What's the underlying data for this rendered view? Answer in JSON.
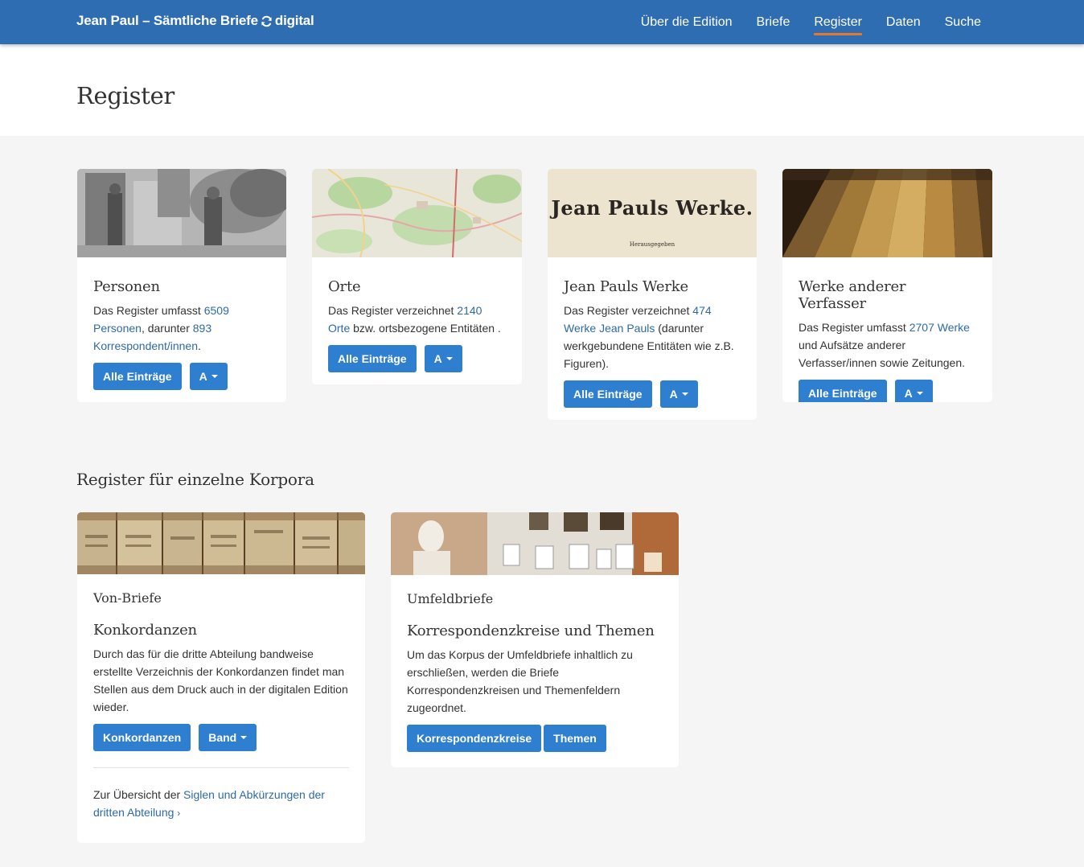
{
  "navbar": {
    "brand_left": "Jean Paul – Sämtliche Briefe",
    "brand_right": "digital",
    "items": [
      {
        "label": "Über die Edition"
      },
      {
        "label": "Briefe"
      },
      {
        "label": "Register"
      },
      {
        "label": "Daten"
      },
      {
        "label": "Suche"
      }
    ],
    "active": "Register"
  },
  "header": {
    "title": "Register"
  },
  "cards": {
    "personen": {
      "title": "Personen",
      "text_1": "Das Register umfasst ",
      "link_1": "6509 Personen",
      "text_2": ", darunter ",
      "link_2": "893 Korrespondent/innen",
      "text_3": ".",
      "btn_all": "Alle Einträge",
      "btn_letter": "A"
    },
    "orte": {
      "title": "Orte",
      "text_1": "Das Register verzeichnet ",
      "link_1": "2140 Orte",
      "text_2": " bzw. ortsbezogene Entitäten .",
      "btn_all": "Alle Einträge",
      "btn_letter": "A"
    },
    "werke": {
      "title": "Jean Pauls Werke",
      "image_text": "Jean Pauls Werke.",
      "image_subtext": "Herausgegeben",
      "text_1": "Das Register verzeichnet ",
      "link_1": "474 Werke Jean Pauls",
      "text_2": " (darunter werkgebundene Entitäten wie z.B. Figuren).",
      "btn_all": "Alle Einträge",
      "btn_letter": "A"
    },
    "andere": {
      "title": "Werke anderer Verfasser",
      "text_1": "Das Register umfasst ",
      "link_1": "2707 Werke",
      "text_2": " und Aufsätze anderer Verfasser/innen sowie Zeitungen.",
      "btn_all": "Alle Einträge",
      "btn_letter": "A"
    }
  },
  "section2": {
    "title": "Register für einzelne Korpora",
    "von_briefe": {
      "label": "Von-Briefe",
      "title": "Konkordanzen",
      "text": "Durch das für die dritte Abteilung bandweise erstellte Verzeichnis der Konkordanzen findet man Stellen aus dem Druck auch in der digitalen Edition wieder.",
      "btn_1": "Konkordanzen",
      "btn_2": "Band",
      "footer_text": "Zur Übersicht der ",
      "footer_link": "Siglen und Abkürzungen der dritten Abteilung",
      "footer_chev": "›"
    },
    "umfeld": {
      "label": "Umfeldbriefe",
      "title": "Korrespondenzkreise und Themen",
      "text": "Um das Korpus der Umfeldbriefe inhaltlich zu erschließen, werden die Briefe Korrespondenzkreisen und Themenfeldern zugeordnet.",
      "btn_1": "Korrespondenzkreise",
      "btn_2": "Themen"
    }
  }
}
